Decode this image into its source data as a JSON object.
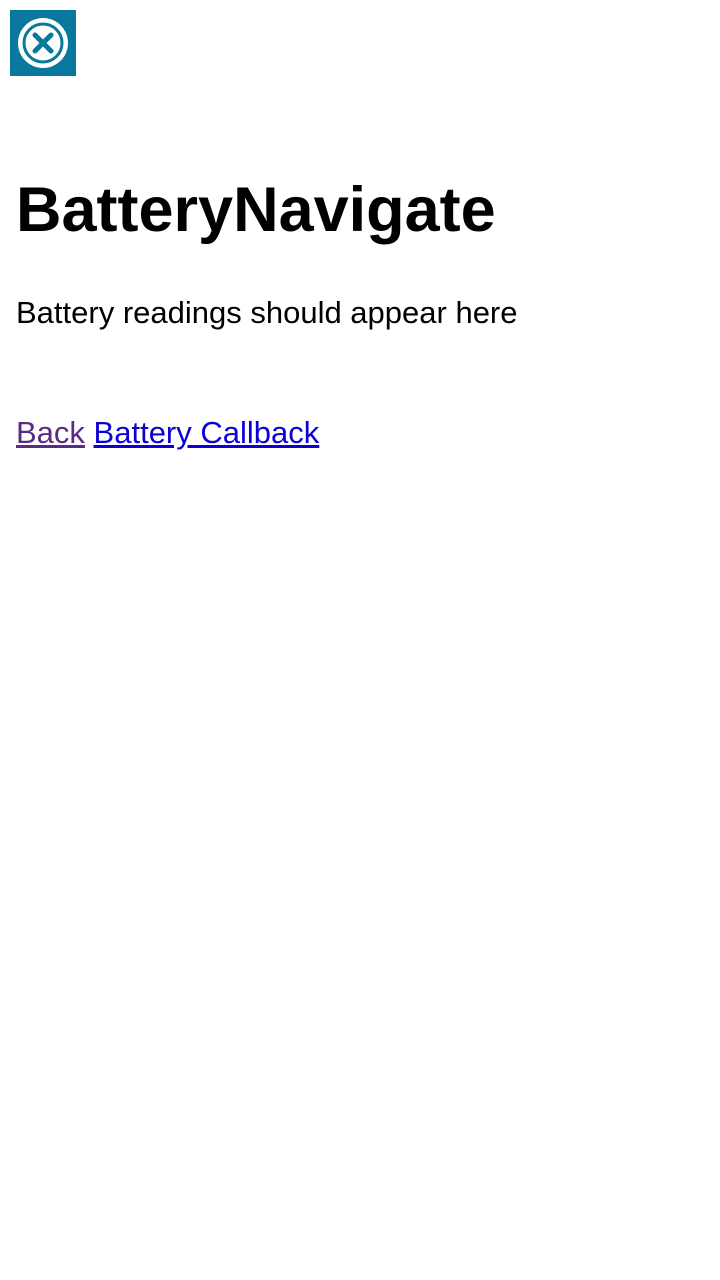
{
  "header": {
    "close_icon": "close-circle-icon",
    "accent_color": "#0a779c"
  },
  "page": {
    "title": "BatteryNavigate",
    "status_text": "Battery readings should appear here"
  },
  "links": [
    {
      "label": "Back",
      "color": "#5b2a86"
    },
    {
      "label": "Battery Callback",
      "color": "#0b00d6"
    }
  ]
}
